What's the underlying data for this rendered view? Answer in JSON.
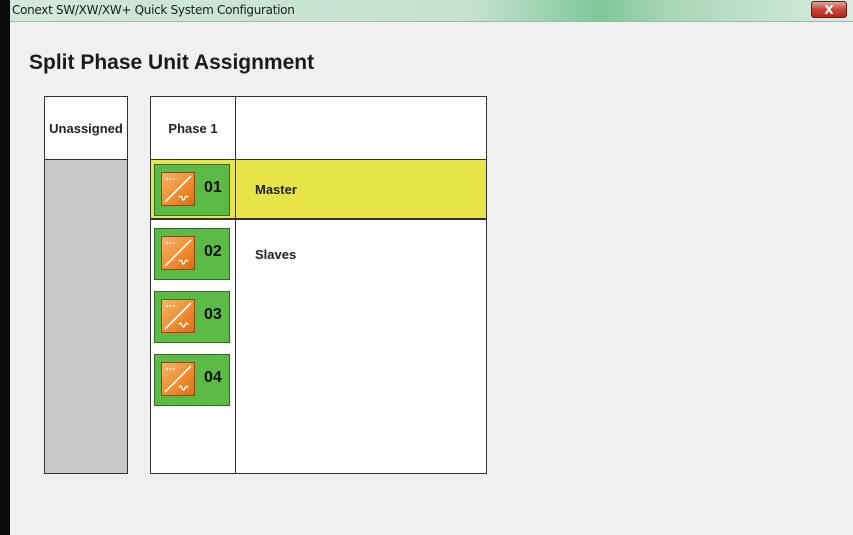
{
  "window": {
    "title": "Conext SW/XW/XW+ Quick System Configuration",
    "close_label": "X"
  },
  "page": {
    "heading": "Split Phase Unit Assignment"
  },
  "table": {
    "unassigned_header": "Unassigned",
    "phase_header": "Phase 1",
    "master_label": "Master",
    "slaves_label": "Slaves",
    "units": [
      {
        "number": "01",
        "role": "master",
        "icon": "inverter-icon"
      },
      {
        "number": "02",
        "role": "slave",
        "icon": "inverter-icon"
      },
      {
        "number": "03",
        "role": "slave",
        "icon": "inverter-icon"
      },
      {
        "number": "04",
        "role": "slave",
        "icon": "inverter-icon"
      }
    ]
  },
  "colors": {
    "master_highlight": "#e6e449",
    "unit_tile": "#5bbb46",
    "unit_icon": "#ee8a2e",
    "unassigned_fill": "#c8c8c8"
  }
}
